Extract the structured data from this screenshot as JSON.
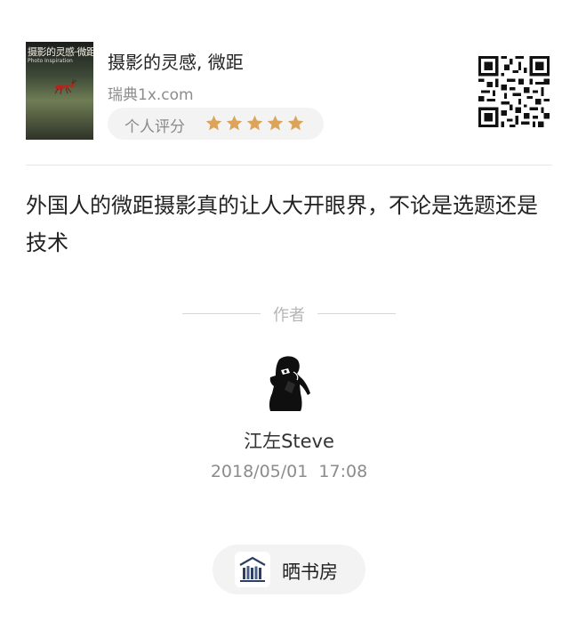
{
  "book": {
    "cover_title": "摄影的灵感·微距",
    "cover_subtitle": "Photo Inspiration",
    "title": "摄影的灵感, 微距",
    "source": "瑞典1x.com",
    "rating_label": "个人评分",
    "rating_stars": 5,
    "rating_max": 5,
    "star_color": "#dca45a"
  },
  "review": {
    "text": "外国人的微距摄影真的让人大开眼界，不论是选题还是技术"
  },
  "author": {
    "section_label": "作者",
    "name": "江左Steve",
    "timestamp": "2018/05/01  17:08"
  },
  "action": {
    "shelf_label": "晒书房",
    "icon": "bookshelf-icon"
  },
  "icons": {
    "qr": "qr-code-icon",
    "avatar": "photographer-silhouette-avatar"
  }
}
